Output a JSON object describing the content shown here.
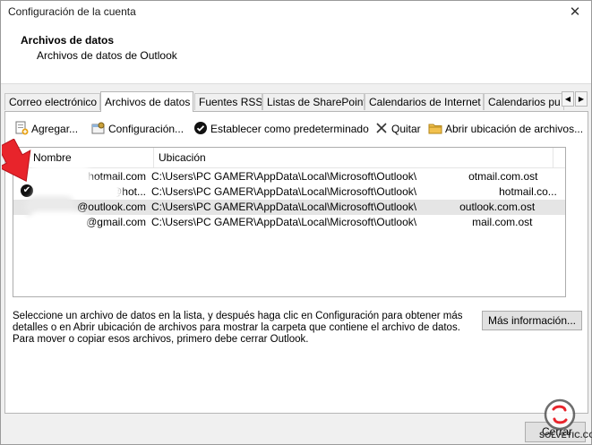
{
  "window": {
    "title": "Configuración de la cuenta",
    "close_glyph": "✕"
  },
  "header": {
    "title": "Archivos de datos",
    "subtitle": "Archivos de datos de Outlook"
  },
  "tabs": [
    {
      "label": "Correo electrónico",
      "active": false
    },
    {
      "label": "Archivos de datos",
      "active": true
    },
    {
      "label": "Fuentes RSS",
      "active": false
    },
    {
      "label": "Listas de SharePoint",
      "active": false
    },
    {
      "label": "Calendarios de Internet",
      "active": false
    },
    {
      "label": "Calendarios pu",
      "active": false
    }
  ],
  "tab_scroll": {
    "left": "◀",
    "right": "▶"
  },
  "toolbar": {
    "add": "Agregar...",
    "settings": "Configuración...",
    "set_default": "Establecer como predeterminado",
    "remove": "Quitar",
    "open_location": "Abrir ubicación de archivos..."
  },
  "list": {
    "columns": {
      "name": "Nombre",
      "location": "Ubicación"
    },
    "rows": [
      {
        "name": "@hotmail.com",
        "location": "C:\\Users\\PC GAMER\\AppData\\Local\\Microsoft\\Outlook\\",
        "location_tail": "otmail.com.ost",
        "default": false,
        "selected": false
      },
      {
        "name": "@hot...",
        "location": "C:\\Users\\PC GAMER\\AppData\\Local\\Microsoft\\Outlook\\",
        "location_tail": "hotmail.co...",
        "default": true,
        "selected": false
      },
      {
        "name": "@outlook.com",
        "location": "C:\\Users\\PC GAMER\\AppData\\Local\\Microsoft\\Outlook\\",
        "location_tail": "outlook.com.ost",
        "default": false,
        "selected": true
      },
      {
        "name": "@gmail.com",
        "location": "C:\\Users\\PC GAMER\\AppData\\Local\\Microsoft\\Outlook\\",
        "location_tail": "mail.com.ost",
        "default": false,
        "selected": false
      }
    ]
  },
  "info": {
    "line1": "Seleccione un archivo de datos en la lista, y después haga clic en Configuración para obtener más",
    "line2": "detalles o en Abrir ubicación de archivos para mostrar la carpeta que contiene el archivo de datos.",
    "line3": "Para mover o copiar esos archivos, primero debe cerrar Outlook."
  },
  "more_info_button": "Más información...",
  "close_button": "Cerrar",
  "watermark": {
    "text": "SOLVETIC.COM"
  },
  "colors": {
    "arrow": "#e8242b",
    "panel_bg": "#ffffff",
    "dialog_bg": "#f0f0f0",
    "selected_row": "#e5e5e5"
  }
}
